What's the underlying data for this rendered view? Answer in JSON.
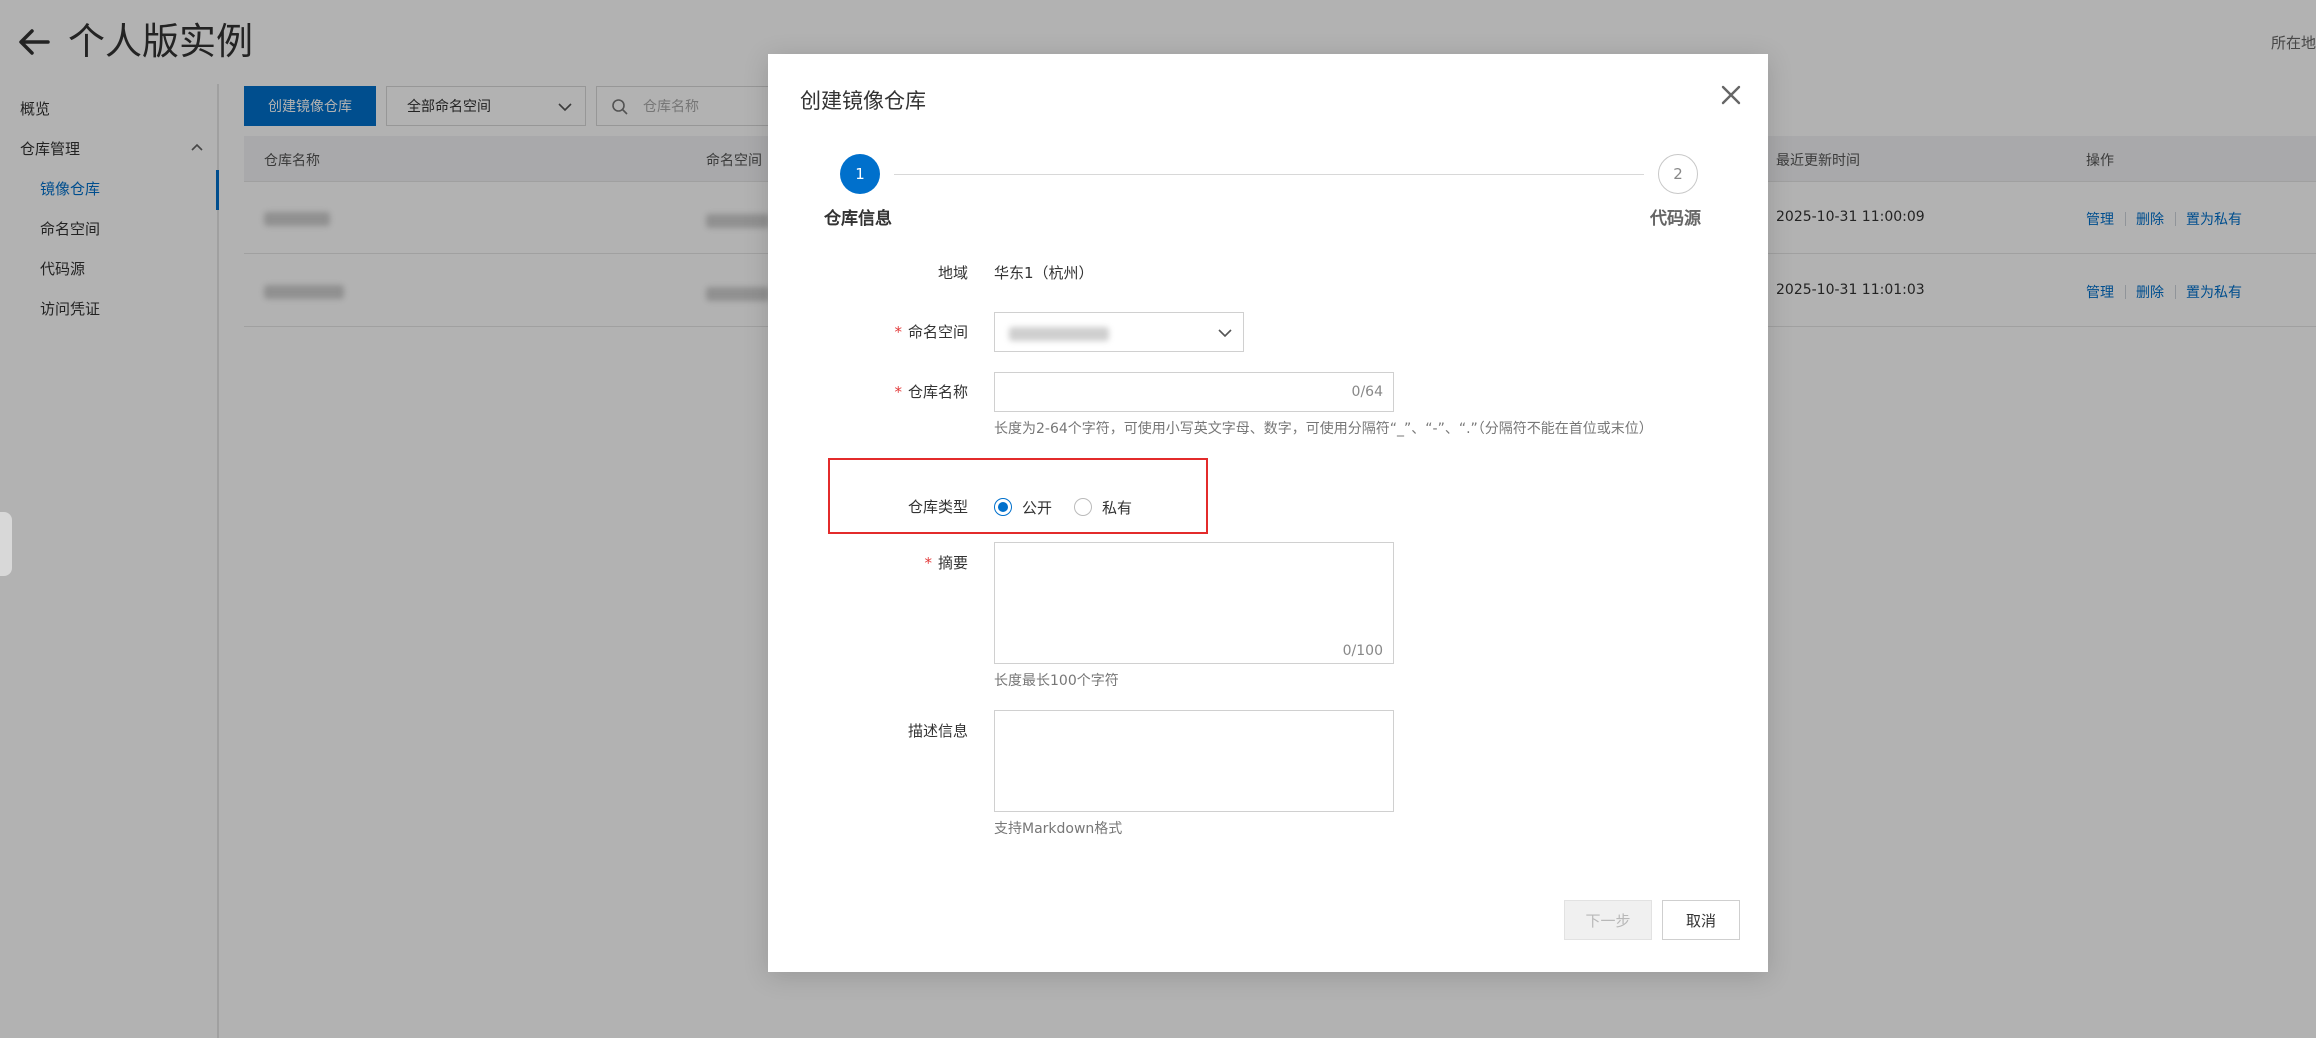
{
  "page": {
    "title": "个人版实例",
    "region_label": "所在地"
  },
  "sidebar": {
    "items": [
      {
        "label": "概览"
      },
      {
        "label": "仓库管理"
      },
      {
        "label": "镜像仓库"
      },
      {
        "label": "命名空间"
      },
      {
        "label": "代码源"
      },
      {
        "label": "访问凭证"
      }
    ]
  },
  "toolbar": {
    "create_label": "创建镜像仓库",
    "namespace_filter": "全部命名空间",
    "search_placeholder": "仓库名称"
  },
  "table": {
    "columns": [
      "仓库名称",
      "命名空间",
      "最近更新时间",
      "操作"
    ],
    "rows": [
      {
        "updated": "2025-10-31 11:00:09"
      },
      {
        "updated": "2025-10-31 11:01:03"
      }
    ],
    "actions": [
      "管理",
      "删除",
      "置为私有"
    ]
  },
  "modal": {
    "title": "创建镜像仓库",
    "steps": [
      {
        "number": "1",
        "label": "仓库信息"
      },
      {
        "number": "2",
        "label": "代码源"
      }
    ],
    "region": {
      "label": "地域",
      "value": "华东1（杭州）"
    },
    "namespace": {
      "label": "命名空间",
      "required_mark": "*"
    },
    "repo_name": {
      "label": "仓库名称",
      "required_mark": "*",
      "count": "0/64",
      "hint": "长度为2-64个字符，可使用小写英文字母、数字，可使用分隔符“_”、“-”、“.”（分隔符不能在首位或末位）"
    },
    "repo_type": {
      "label": "仓库类型",
      "options": [
        {
          "label": "公开",
          "selected": true
        },
        {
          "label": "私有",
          "selected": false
        }
      ]
    },
    "summary": {
      "label": "摘要",
      "required_mark": "*",
      "count": "0/100",
      "hint": "长度最长100个字符"
    },
    "description": {
      "label": "描述信息",
      "hint": "支持Markdown格式"
    },
    "buttons": {
      "next": "下一步",
      "cancel": "取消"
    }
  },
  "colors": {
    "accent": "#0070cc",
    "highlight": "#e32b2b",
    "required": "#e23b3b"
  }
}
